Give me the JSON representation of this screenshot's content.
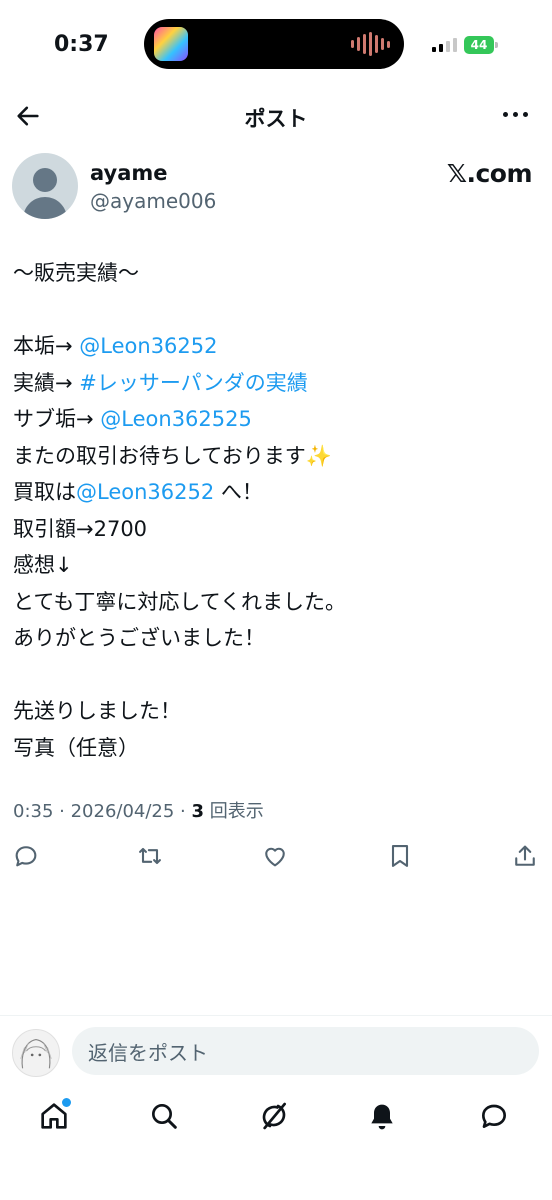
{
  "status_bar": {
    "time": "0:37",
    "battery": "44"
  },
  "header": {
    "title": "ポスト"
  },
  "author": {
    "display_name": "ayame",
    "handle": "@ayame006",
    "brand": "𝕏.com"
  },
  "post": {
    "lines": [
      [
        {
          "t": "〜販売実績〜",
          "k": "text"
        }
      ],
      [],
      [
        {
          "t": "本垢→ ",
          "k": "text"
        },
        {
          "t": "@Leon36252",
          "k": "link"
        }
      ],
      [
        {
          "t": "実績→ ",
          "k": "text"
        },
        {
          "t": "#レッサーパンダの実績",
          "k": "link"
        }
      ],
      [
        {
          "t": "サブ垢→ ",
          "k": "text"
        },
        {
          "t": "@Leon362525",
          "k": "link"
        }
      ],
      [
        {
          "t": "またの取引お待ちしております",
          "k": "text"
        },
        {
          "t": "✨",
          "k": "sparkle"
        }
      ],
      [
        {
          "t": "買取は",
          "k": "text"
        },
        {
          "t": "@Leon36252",
          "k": "link"
        },
        {
          "t": " へ！",
          "k": "text"
        }
      ],
      [
        {
          "t": "取引額→2700",
          "k": "text"
        }
      ],
      [
        {
          "t": "感想↓",
          "k": "text"
        }
      ],
      [
        {
          "t": "とても丁寧に対応してくれました。",
          "k": "text"
        }
      ],
      [
        {
          "t": "ありがとうございました！",
          "k": "text"
        }
      ],
      [],
      [
        {
          "t": "先送りしました！",
          "k": "text"
        }
      ],
      [
        {
          "t": "写真（任意）",
          "k": "text"
        }
      ]
    ],
    "time": "0:35 · 2026/04/25 · ",
    "views_count": "3",
    "views_label": " 回表示"
  },
  "actions": {
    "icons": [
      "reply-icon",
      "repost-icon",
      "like-icon",
      "bookmark-icon",
      "share-icon"
    ]
  },
  "compose": {
    "placeholder": "返信をポスト"
  },
  "tabbar": {
    "icons": [
      "home-icon",
      "search-icon",
      "grok-icon",
      "notifications-icon",
      "messages-icon"
    ]
  },
  "colors": {
    "link": "#1d9bf0",
    "text": "#0f1419",
    "muted": "#536471",
    "battery": "#34c759"
  }
}
